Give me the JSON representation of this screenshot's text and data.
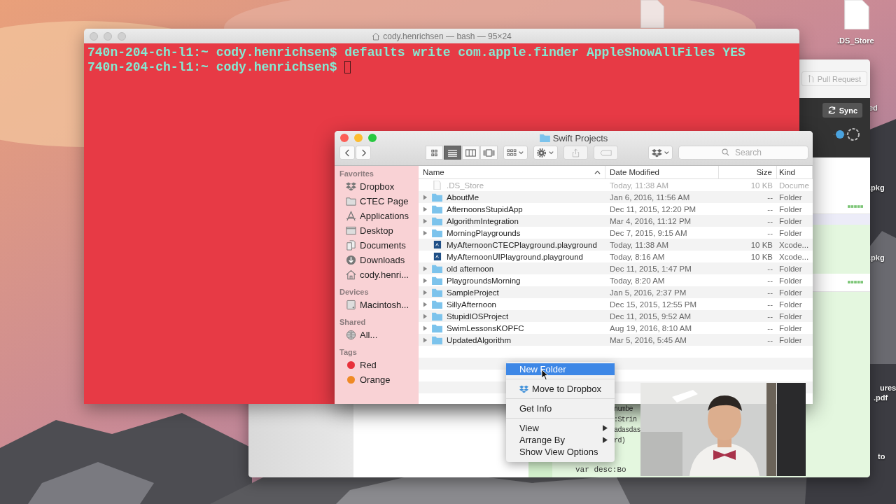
{
  "desktop": {
    "icons": [
      {
        "label": ".DS_Store",
        "kind": "file"
      },
      {
        "label": "ed",
        "kind": "label"
      },
      {
        "label": ".pkg",
        "kind": "label"
      },
      {
        "label": ".pkg",
        "kind": "label"
      },
      {
        "label": "ures",
        "kind": "label"
      },
      {
        "label": ".pdf",
        "kind": "label"
      },
      {
        "label": "to",
        "kind": "label"
      }
    ]
  },
  "github_window": {
    "buttons": [
      "Pull Request",
      "Sync"
    ],
    "code_lines": [
      "numbe",
      ":Strin",
      "adasdas",
      "rd)",
      "var desc:Bo"
    ]
  },
  "terminal": {
    "title": "cody.henrichsen — bash — 95×24",
    "lines": [
      "740n-204-ch-l1:~ cody.henrichsen$ defaults write com.apple.finder AppleShowAllFiles YES",
      "740n-204-ch-l1:~ cody.henrichsen$"
    ]
  },
  "finder": {
    "title": "Swift Projects",
    "view_modes": [
      {
        "kind": "icons",
        "selected": false
      },
      {
        "kind": "list",
        "selected": true
      },
      {
        "kind": "columns",
        "selected": false
      },
      {
        "kind": "coverflow",
        "selected": false
      }
    ],
    "search": {
      "placeholder": "Search"
    },
    "sidebar": [
      {
        "heading": "Favorites",
        "items": [
          {
            "label": "Dropbox",
            "kind": "dropbox"
          },
          {
            "label": "CTEC Page",
            "kind": "folder"
          },
          {
            "label": "Applications",
            "kind": "applications"
          },
          {
            "label": "Desktop",
            "kind": "desktop"
          },
          {
            "label": "Documents",
            "kind": "documents"
          },
          {
            "label": "Downloads",
            "kind": "downloads"
          },
          {
            "label": "cody.henri...",
            "kind": "home"
          }
        ]
      },
      {
        "heading": "Devices",
        "items": [
          {
            "label": "Macintosh...",
            "kind": "disk"
          }
        ]
      },
      {
        "heading": "Shared",
        "items": [
          {
            "label": "All...",
            "kind": "network"
          }
        ]
      },
      {
        "heading": "Tags",
        "items": [
          {
            "label": "Red",
            "kind": "tag",
            "color": "#e8303a"
          },
          {
            "label": "Orange",
            "kind": "tag",
            "color": "#ef8a25"
          }
        ]
      }
    ],
    "columns": [
      {
        "label": "Name",
        "sorted": true
      },
      {
        "label": "Date Modified",
        "sorted": false
      },
      {
        "label": "Size",
        "sorted": false
      },
      {
        "label": "Kind",
        "sorted": false
      }
    ],
    "rows": [
      {
        "name": ".DS_Store",
        "date": "Today, 11:38 AM",
        "size": "10 KB",
        "type": "Docume",
        "kind": "file",
        "dimmed": true
      },
      {
        "name": "AboutMe",
        "date": "Jan 6, 2016, 11:56 AM",
        "size": "--",
        "type": "Folder",
        "kind": "folder",
        "dimmed": false
      },
      {
        "name": "AfternoonsStupidApp",
        "date": "Dec 11, 2015, 12:20 PM",
        "size": "--",
        "type": "Folder",
        "kind": "folder",
        "dimmed": false
      },
      {
        "name": "AlgorithmIntegration",
        "date": "Mar 4, 2016, 11:12 PM",
        "size": "--",
        "type": "Folder",
        "kind": "folder",
        "dimmed": false
      },
      {
        "name": "MorningPlaygrounds",
        "date": "Dec 7, 2015, 9:15 AM",
        "size": "--",
        "type": "Folder",
        "kind": "folder",
        "dimmed": false
      },
      {
        "name": "MyAfternoonCTECPlayground.playground",
        "date": "Today, 11:38 AM",
        "size": "10 KB",
        "type": "Xcode...",
        "kind": "playground",
        "dimmed": false
      },
      {
        "name": "MyAfternoonUIPlayground.playground",
        "date": "Today, 8:16 AM",
        "size": "10 KB",
        "type": "Xcode...",
        "kind": "playground",
        "dimmed": false
      },
      {
        "name": "old afternoon",
        "date": "Dec 11, 2015, 1:47 PM",
        "size": "--",
        "type": "Folder",
        "kind": "folder",
        "dimmed": false
      },
      {
        "name": "PlaygroundsMorning",
        "date": "Today, 8:20 AM",
        "size": "--",
        "type": "Folder",
        "kind": "folder",
        "dimmed": false
      },
      {
        "name": "SampleProject",
        "date": "Jan 5, 2016, 2:37 PM",
        "size": "--",
        "type": "Folder",
        "kind": "folder",
        "dimmed": false
      },
      {
        "name": "SillyAfternoon",
        "date": "Dec 15, 2015, 12:55 PM",
        "size": "--",
        "type": "Folder",
        "kind": "folder",
        "dimmed": false
      },
      {
        "name": "StupidIOSProject",
        "date": "Dec 11, 2015, 9:52 AM",
        "size": "--",
        "type": "Folder",
        "kind": "folder",
        "dimmed": false
      },
      {
        "name": "SwimLessonsKOPFC",
        "date": "Aug 19, 2016, 8:10 AM",
        "size": "--",
        "type": "Folder",
        "kind": "folder",
        "dimmed": false
      },
      {
        "name": "UpdatedAlgorithm",
        "date": "Mar 5, 2016, 5:45 AM",
        "size": "--",
        "type": "Folder",
        "kind": "folder",
        "dimmed": false
      }
    ]
  },
  "context_menu": {
    "groups": [
      [
        {
          "label": "New Folder",
          "kind": "plain",
          "selected": true,
          "submenu": false
        }
      ],
      [
        {
          "label": "Move to Dropbox",
          "kind": "with_icon",
          "selected": false,
          "submenu": false
        }
      ],
      [
        {
          "label": "Get Info",
          "kind": "plain",
          "selected": false,
          "submenu": false
        }
      ],
      [
        {
          "label": "View",
          "kind": "plain",
          "selected": false,
          "submenu": true
        },
        {
          "label": "Arrange By",
          "kind": "plain",
          "selected": false,
          "submenu": true
        },
        {
          "label": "Show View Options",
          "kind": "plain",
          "selected": false,
          "submenu": false
        }
      ]
    ]
  }
}
